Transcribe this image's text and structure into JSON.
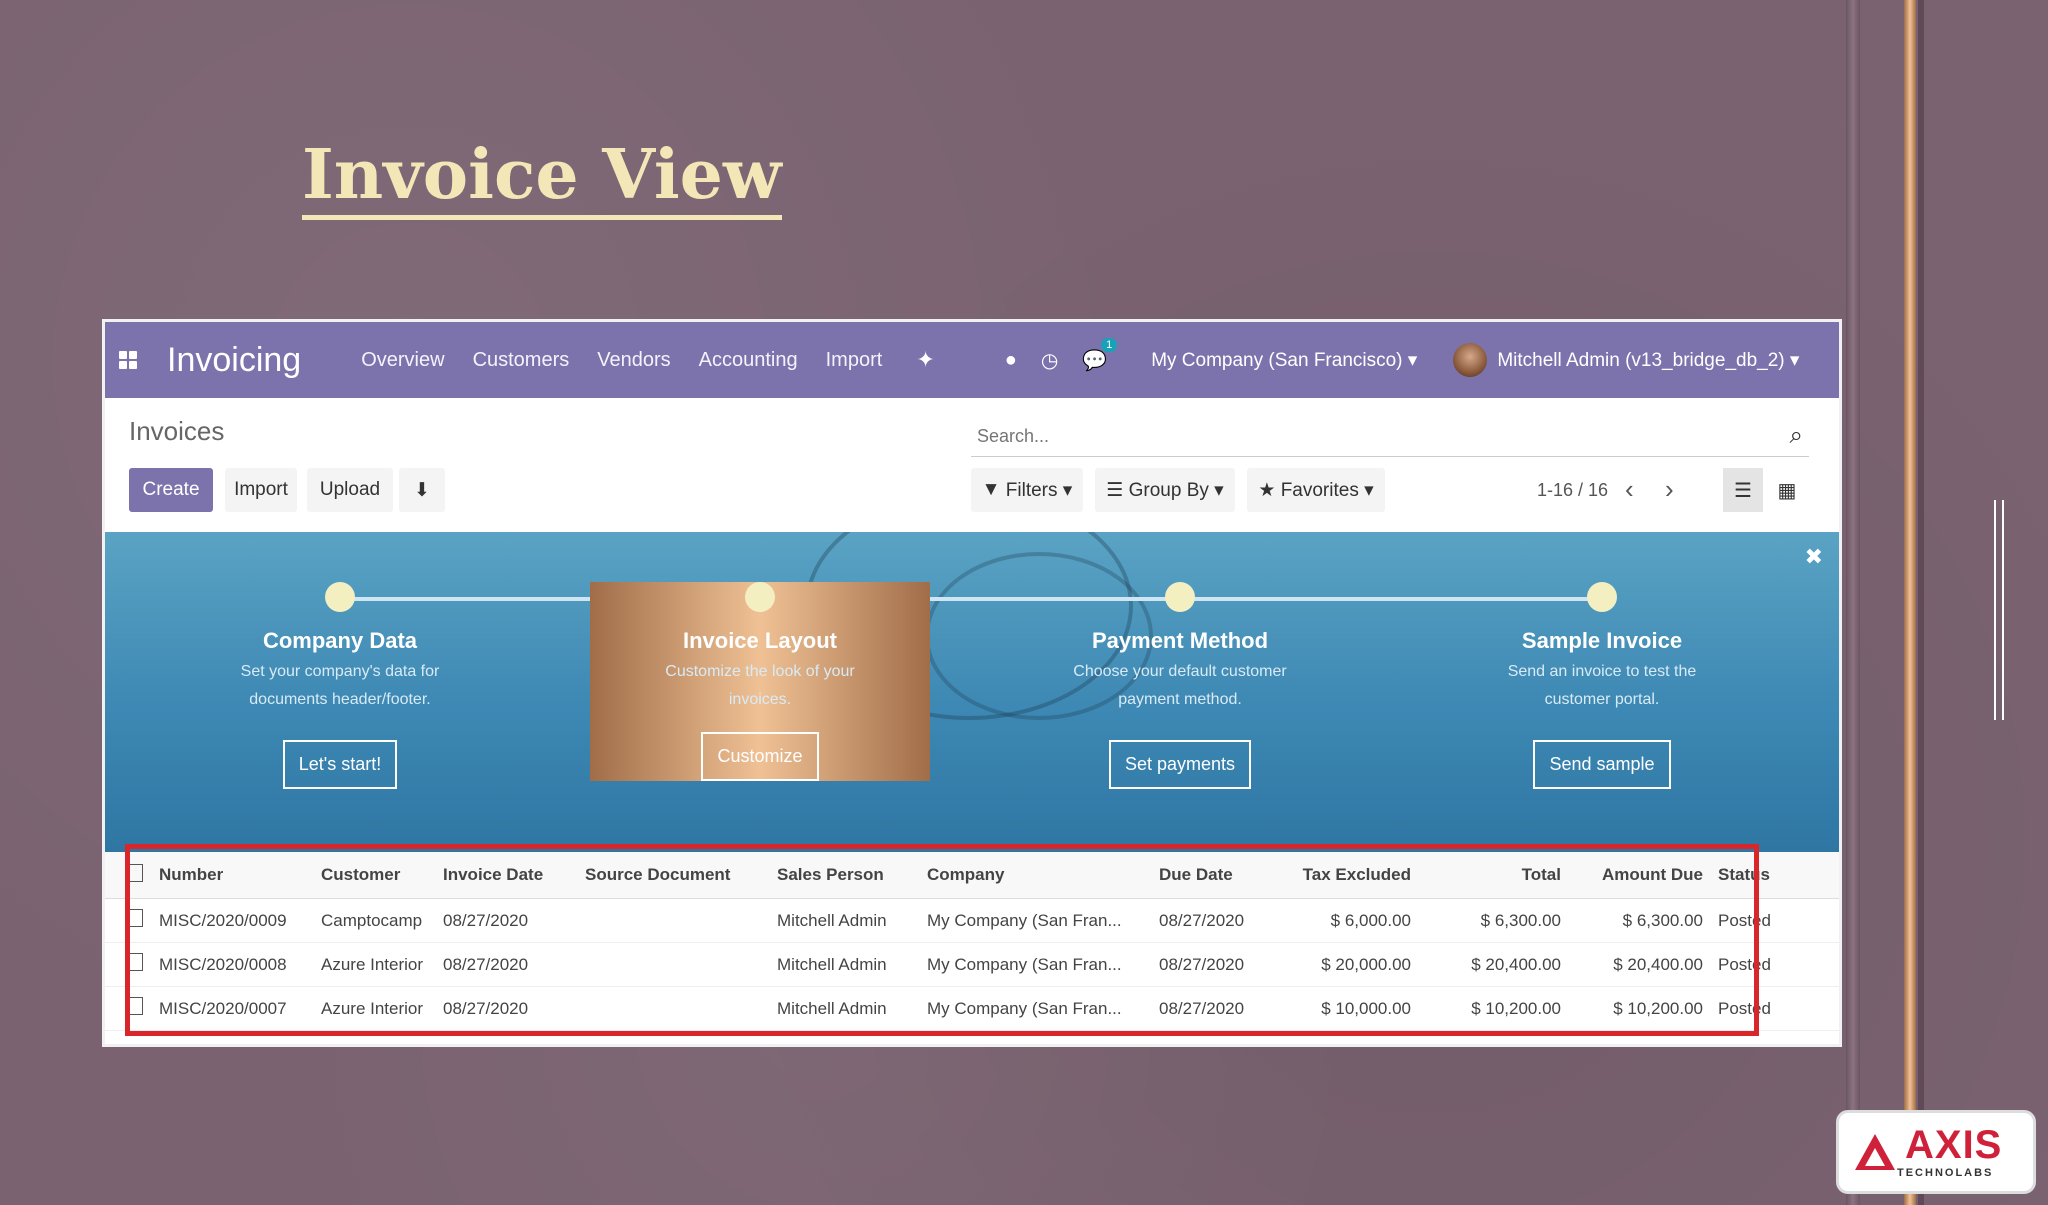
{
  "slide": {
    "title": "Invoice View"
  },
  "navbar": {
    "app_name": "Invoicing",
    "menu": [
      "Overview",
      "Customers",
      "Vendors",
      "Accounting",
      "Import"
    ],
    "messages_badge": "1",
    "company": "My Company (San Francisco) ▾",
    "user": "Mitchell Admin (v13_bridge_db_2) ▾"
  },
  "control_panel": {
    "breadcrumb": "Invoices",
    "search_placeholder": "Search...",
    "create_label": "Create",
    "import_label": "Import",
    "upload_label": "Upload",
    "filters_label": "Filters ▾",
    "groupby_label": "Group By ▾",
    "favorites_label": "Favorites ▾",
    "pager": "1-16 / 16"
  },
  "onboarding": {
    "steps": [
      {
        "title": "Company Data",
        "desc": "Set your company's data for documents header/footer.",
        "button": "Let's start!"
      },
      {
        "title": "Invoice Layout",
        "desc": "Customize the look of your invoices.",
        "button": "Customize"
      },
      {
        "title": "Payment Method",
        "desc": "Choose your default customer payment method.",
        "button": "Set payments"
      },
      {
        "title": "Sample Invoice",
        "desc": "Send an invoice to test the customer portal.",
        "button": "Send sample"
      }
    ]
  },
  "table": {
    "headers": [
      "Number",
      "Customer",
      "Invoice Date",
      "Source Document",
      "Sales Person",
      "Company",
      "Due Date",
      "Tax Excluded",
      "Total",
      "Amount Due",
      "Status"
    ],
    "rows": [
      {
        "number": "MISC/2020/0009",
        "customer": "Camptocamp",
        "invoice_date": "08/27/2020",
        "source": "",
        "salesperson": "Mitchell Admin",
        "company": "My Company (San Fran...",
        "due_date": "08/27/2020",
        "tax_excluded": "$ 6,000.00",
        "total": "$ 6,300.00",
        "amount_due": "$ 6,300.00",
        "status": "Posted"
      },
      {
        "number": "MISC/2020/0008",
        "customer": "Azure Interior",
        "invoice_date": "08/27/2020",
        "source": "",
        "salesperson": "Mitchell Admin",
        "company": "My Company (San Fran...",
        "due_date": "08/27/2020",
        "tax_excluded": "$ 20,000.00",
        "total": "$ 20,400.00",
        "amount_due": "$ 20,400.00",
        "status": "Posted"
      },
      {
        "number": "MISC/2020/0007",
        "customer": "Azure Interior",
        "invoice_date": "08/27/2020",
        "source": "",
        "salesperson": "Mitchell Admin",
        "company": "My Company (San Fran...",
        "due_date": "08/27/2020",
        "tax_excluded": "$ 10,000.00",
        "total": "$ 10,200.00",
        "amount_due": "$ 10,200.00",
        "status": "Posted"
      }
    ]
  },
  "logo": {
    "name": "AXIS",
    "sub": "TECHNOLABS"
  },
  "colors": {
    "navbar": "#7c73ad",
    "highlight": "#d9262a",
    "title": "#f3e7b8"
  }
}
